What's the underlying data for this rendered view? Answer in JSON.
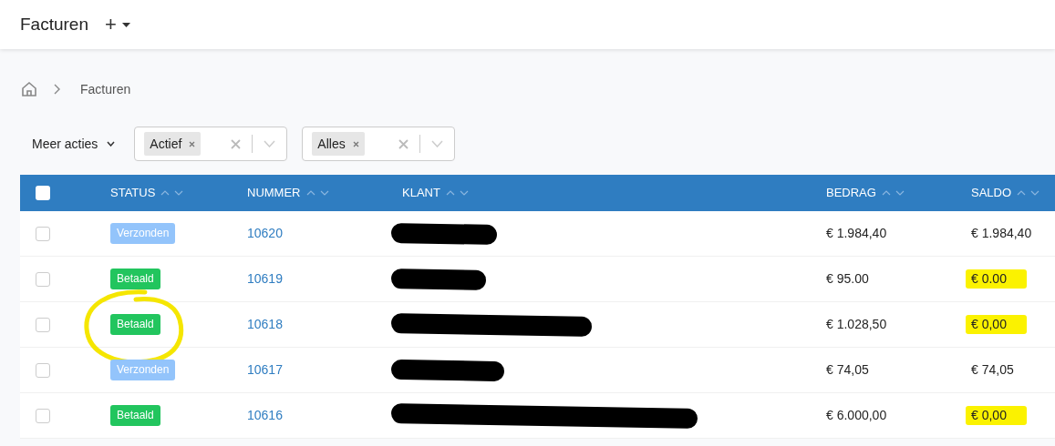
{
  "header": {
    "title": "Facturen",
    "add_label": "+"
  },
  "breadcrumb": {
    "items": [
      "Facturen"
    ]
  },
  "toolbar": {
    "actions_label": "Meer acties",
    "filters": [
      {
        "tag": "Actief"
      },
      {
        "tag": "Alles"
      }
    ]
  },
  "table": {
    "select_all_checked": false,
    "columns": [
      {
        "label": "STATUS"
      },
      {
        "label": "NUMMER"
      },
      {
        "label": "KLANT"
      },
      {
        "label": "BEDRAG"
      },
      {
        "label": "SALDO"
      }
    ],
    "rows": [
      {
        "checked": false,
        "status": "Verzonden",
        "kind": "sent",
        "number": "10620",
        "client_redacted": true,
        "amount": "€ 1.984,40",
        "balance": "€ 1.984,40",
        "balance_highlighted": false,
        "status_circled": false
      },
      {
        "checked": false,
        "status": "Betaald",
        "kind": "paid",
        "number": "10619",
        "client_redacted": true,
        "amount": "€ 95.00",
        "balance": "€ 0.00",
        "balance_highlighted": true,
        "status_circled": false
      },
      {
        "checked": false,
        "status": "Betaald",
        "kind": "paid",
        "number": "10618",
        "client_redacted": true,
        "amount": "€ 1.028,50",
        "balance": "€ 0,00",
        "balance_highlighted": true,
        "status_circled": true
      },
      {
        "checked": false,
        "status": "Verzonden",
        "kind": "sent",
        "number": "10617",
        "client_redacted": true,
        "amount": "€ 74,05",
        "balance": "€ 74,05",
        "balance_highlighted": false,
        "status_circled": false
      },
      {
        "checked": false,
        "status": "Betaald",
        "kind": "paid",
        "number": "10616",
        "client_redacted": true,
        "amount": "€ 6.000,00",
        "balance": "€ 0,00",
        "balance_highlighted": true,
        "status_circled": false
      }
    ]
  }
}
